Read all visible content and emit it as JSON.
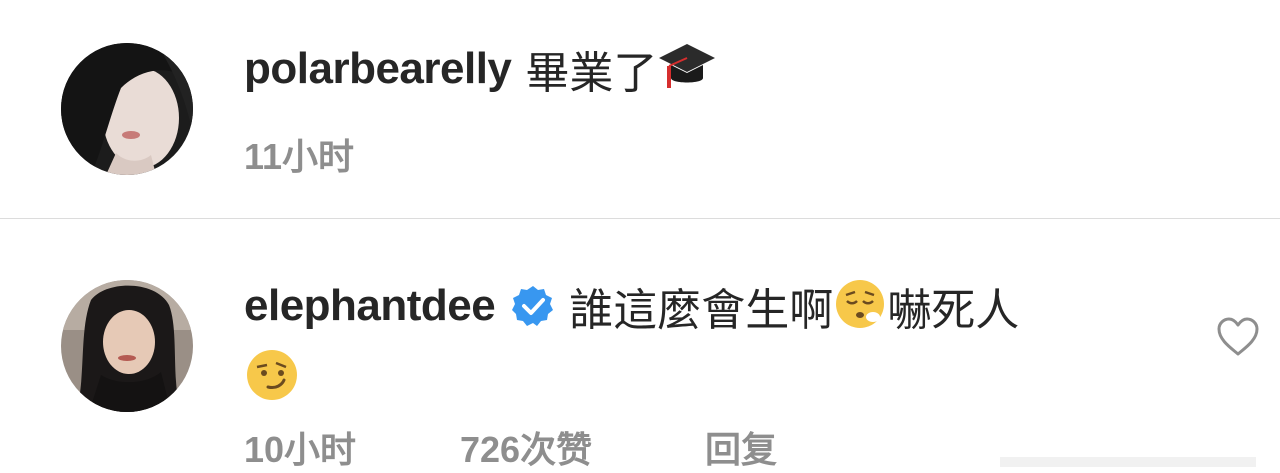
{
  "comments": [
    {
      "username": "polarbearelly",
      "text": "畢業了",
      "emojis": [
        "graduation-cap-icon"
      ],
      "time": "11小时"
    },
    {
      "username": "elephantdee",
      "verified": true,
      "text_part1": "誰這麼會生啊",
      "text_part2": "嚇死人",
      "emojis": [
        "relieved-face-icon",
        "smirking-face-icon"
      ],
      "time": "10小时",
      "likes": "726次赞",
      "reply_label": "回复"
    }
  ],
  "colors": {
    "text": "#262626",
    "meta": "#8e8e8e",
    "verified_badge": "#3897f0",
    "divider": "#dcdcdc"
  }
}
